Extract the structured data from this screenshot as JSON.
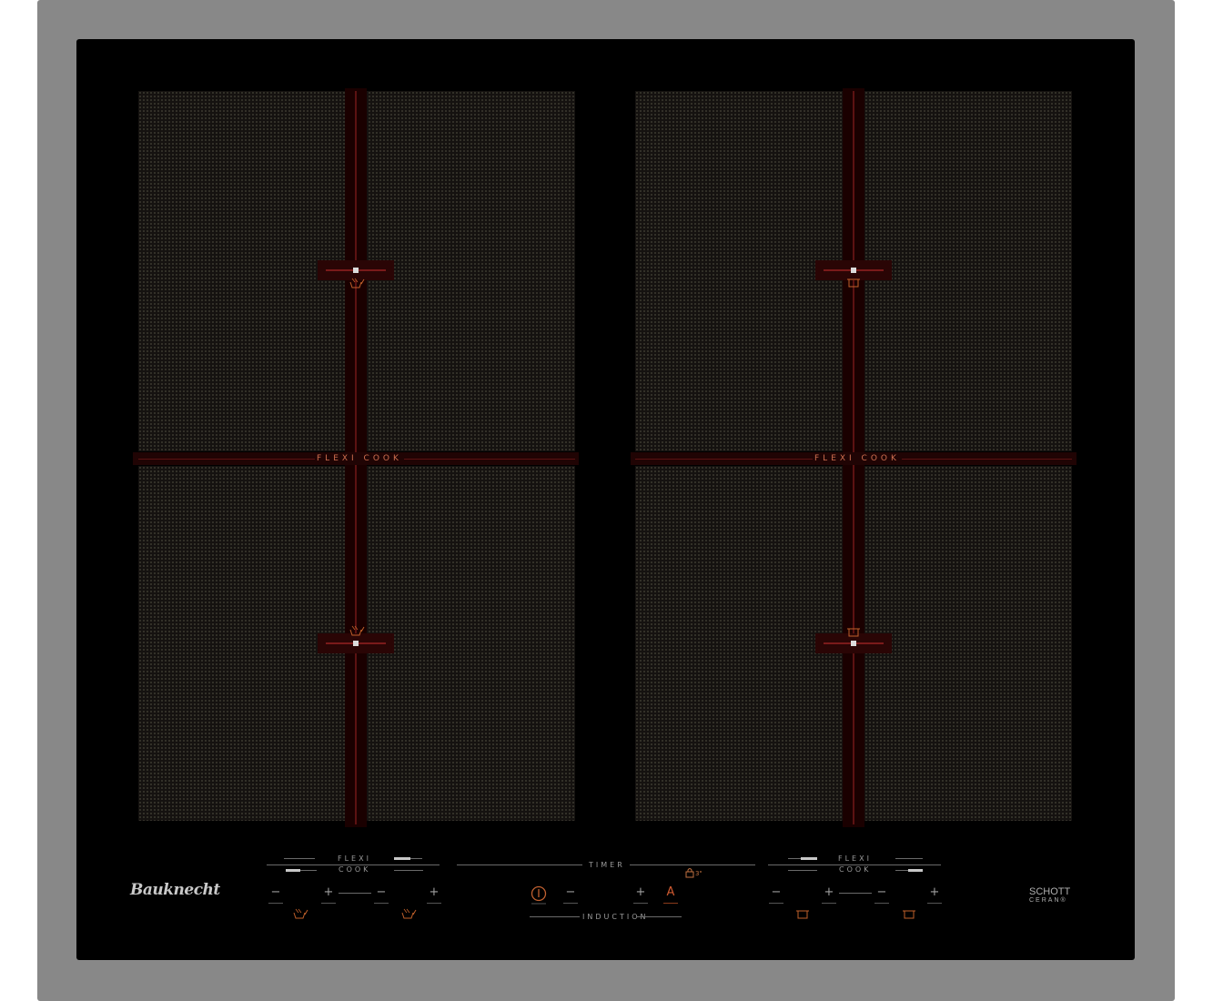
{
  "product": {
    "brand": "Bauknecht",
    "glass_brand": "SCHOTT",
    "glass_type": "CERAN®"
  },
  "cooktop": {
    "left_zone_label": "FLEXI COOK",
    "right_zone_label": "FLEXI COOK"
  },
  "controls": {
    "left_flexi": "FLEXI",
    "left_cook": "COOK",
    "right_flexi": "FLEXI",
    "right_cook": "COOK",
    "timer": "TIMER",
    "induction": "INDUCTION",
    "lock_time": "3\"",
    "minus": "−",
    "plus": "+",
    "auto": "A"
  },
  "colors": {
    "frame": "#888888",
    "glass": "#000000",
    "accent": "#d05a30",
    "zone_marking": "#5c1212"
  }
}
